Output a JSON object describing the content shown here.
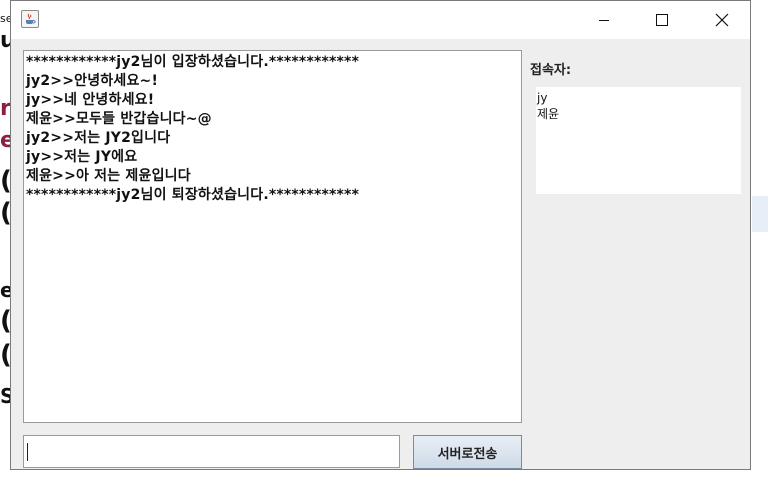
{
  "background_fragments": [
    "se",
    "u",
    "r",
    "e",
    "(",
    "(",
    "e",
    "(",
    "(",
    "S"
  ],
  "window": {
    "icon": "java-cup-icon",
    "controls": [
      "minimize-icon",
      "maximize-icon",
      "close-icon"
    ]
  },
  "chat": {
    "lines": [
      "************jy2님이 입장하셨습니다.************",
      "jy2>>안녕하세요~!",
      "jy>>네 안녕하세요!",
      "제윤>>모두들 반갑습니다~@",
      "jy2>>저는 JY2입니다",
      "jy>>저는 JY에요",
      "제윤>>아 저는 제윤입니다",
      "************jy2님이 퇴장하셨습니다.************"
    ]
  },
  "users": {
    "label": "접속자:",
    "items": [
      "jy",
      "제윤"
    ]
  },
  "input": {
    "value": ""
  },
  "send_button": {
    "label": "서버로전송"
  }
}
